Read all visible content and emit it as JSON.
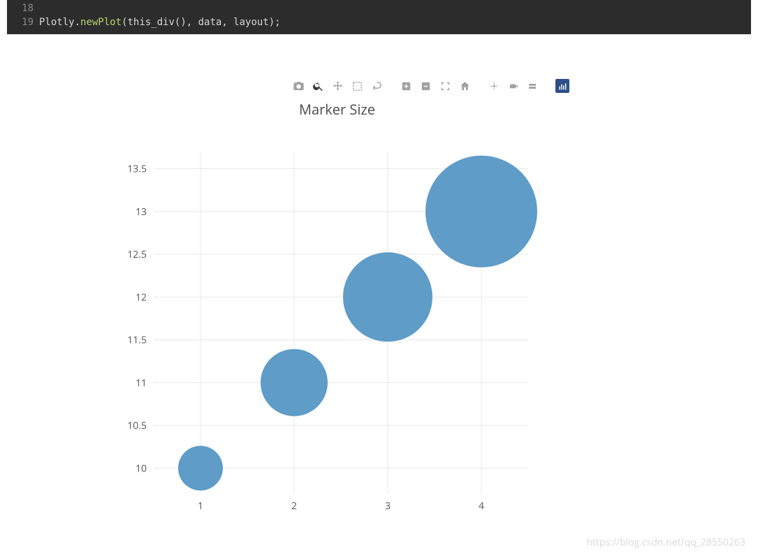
{
  "code": {
    "line18": {
      "num": "18",
      "text": ""
    },
    "line19": {
      "num": "19",
      "prefix": "Plotly.",
      "fn": "newPlot",
      "args": "(this_div(), data, layout);"
    }
  },
  "modebar": {
    "camera": "camera-icon",
    "zoom": "zoom-icon",
    "pan": "pan-icon",
    "box_select": "box-select-icon",
    "lasso": "lasso-icon",
    "zoom_in": "zoom-in-icon",
    "zoom_out": "zoom-out-icon",
    "autoscale": "autoscale-icon",
    "reset": "reset-axes-icon",
    "spike": "spike-icon",
    "hover_closest": "hover-closest-icon",
    "hover_compare": "hover-compare-icon",
    "plotly_logo": "plotly-logo-icon"
  },
  "chart_data": {
    "type": "scatter",
    "mode": "markers",
    "title": "Marker Size",
    "x": [
      1,
      2,
      3,
      4
    ],
    "y": [
      10,
      11,
      12,
      13
    ],
    "marker_size": [
      40,
      60,
      80,
      100
    ],
    "xlabel": "",
    "ylabel": "",
    "xlim": [
      0.5,
      4.5
    ],
    "ylim": [
      9.7,
      13.7
    ],
    "x_ticks": [
      1,
      2,
      3,
      4
    ],
    "y_ticks": [
      10,
      10.5,
      11,
      11.5,
      12,
      12.5,
      13,
      13.5
    ],
    "marker_color": "#5f9cc7"
  },
  "watermark": "https://blog.csdn.net/qq_28550263"
}
